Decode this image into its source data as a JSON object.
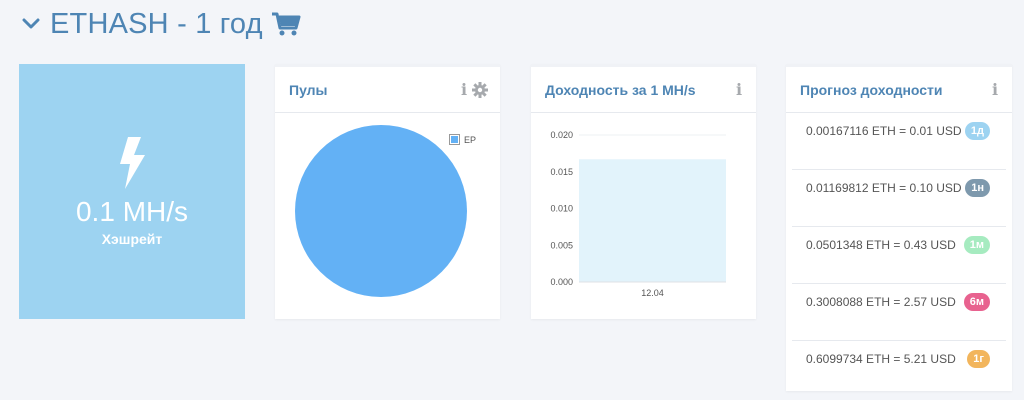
{
  "header": {
    "title": "ETHASH - 1 год",
    "icons": [
      "chevron-down-icon",
      "cart-icon"
    ]
  },
  "hashrate": {
    "value": "0.1 MH/s",
    "label": "Хэшрейт",
    "icon": "lightning-icon",
    "bg_color": "#9dd3f1"
  },
  "pools": {
    "title": "Пулы",
    "icons": [
      "info-icon",
      "gear-icon"
    ],
    "info_glyph": "i",
    "chart_data": {
      "type": "pie",
      "slices": [
        {
          "label": "EP",
          "value": 100,
          "color": "#63b1f5"
        }
      ],
      "legend_position": "top-right"
    }
  },
  "yield": {
    "title": "Доходность за 1 MH/s",
    "info_glyph": "i",
    "chart_data": {
      "type": "bar",
      "categories": [
        "12.04"
      ],
      "values": [
        0.0167
      ],
      "ylim": [
        0,
        0.02
      ],
      "yticks": [
        "0.020",
        "0.015",
        "0.010",
        "0.005",
        "0.000"
      ],
      "grid": true,
      "bar_color": "#e2f3fb"
    }
  },
  "forecast": {
    "title": "Прогноз доходности",
    "info_glyph": "i",
    "rows": [
      {
        "text": "0.00167116 ETH = 0.01 USD",
        "badge": "1д",
        "color": "#9dd3f1"
      },
      {
        "text": "0.01169812 ETH = 0.10 USD",
        "badge": "1н",
        "color": "#7e99ad"
      },
      {
        "text": "0.0501348 ETH = 0.43 USD",
        "badge": "1м",
        "color": "#a6ebc0"
      },
      {
        "text": "0.3008088 ETH = 2.57 USD",
        "badge": "6м",
        "color": "#e8628f"
      },
      {
        "text": "0.6099734 ETH = 5.21 USD",
        "badge": "1г",
        "color": "#f2b55c"
      }
    ]
  },
  "colors": {
    "accent": "#4e85b4",
    "background": "#f3f5f9"
  }
}
